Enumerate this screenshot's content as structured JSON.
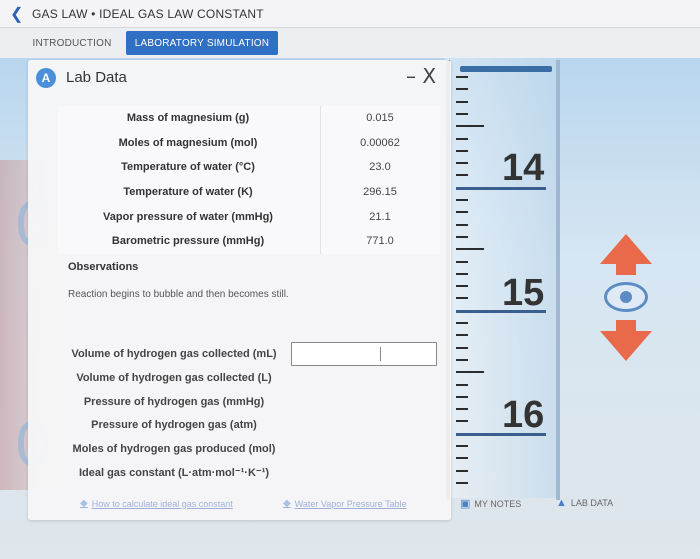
{
  "header": {
    "title": "GAS LAW • IDEAL GAS LAW CONSTANT",
    "back_icon": "chevron-left-icon"
  },
  "tabs": [
    {
      "label": "INTRODUCTION",
      "active": false
    },
    {
      "label": "LABORATORY SIMULATION",
      "active": true
    }
  ],
  "panel": {
    "badge": "A",
    "title": "Lab Data",
    "close_label": "– X",
    "data_rows": [
      {
        "label": "Mass of magnesium (g)",
        "value": "0.015"
      },
      {
        "label": "Moles of magnesium (mol)",
        "value": "0.00062"
      },
      {
        "label": "Temperature of water (°C)",
        "value": "23.0"
      },
      {
        "label": "Temperature of water (K)",
        "value": "296.15"
      },
      {
        "label": "Vapor pressure of water (mmHg)",
        "value": "21.1"
      },
      {
        "label": "Barometric pressure (mmHg)",
        "value": "771.0"
      }
    ],
    "observations_label": "Observations",
    "observations_text": "Reaction begins to bubble and then becomes still.",
    "calc_rows": [
      "Volume of hydrogen gas collected (mL)",
      "Volume of hydrogen gas collected (L)",
      "Pressure of hydrogen gas (mmHg)",
      "Pressure of hydrogen gas (atm)",
      "Moles of hydrogen gas produced (mol)",
      "Ideal gas constant (L·atm·mol⁻¹·K⁻¹)"
    ],
    "answer_input": {
      "value": "",
      "placeholder": ""
    },
    "links": [
      {
        "label": "How to calculate ideal gas constant",
        "icon": "tag-icon"
      },
      {
        "label": "Water Vapor Pressure Table",
        "icon": "tag-icon"
      }
    ]
  },
  "cylinder": {
    "numbers": [
      "14",
      "15",
      "16"
    ]
  },
  "footer": {
    "notes_label": "MY NOTES",
    "lab_data_label": "LAB DATA"
  },
  "colors": {
    "accent": "#2f6fc4",
    "arrow": "#e86a4a",
    "eye": "#5b8dc4"
  }
}
